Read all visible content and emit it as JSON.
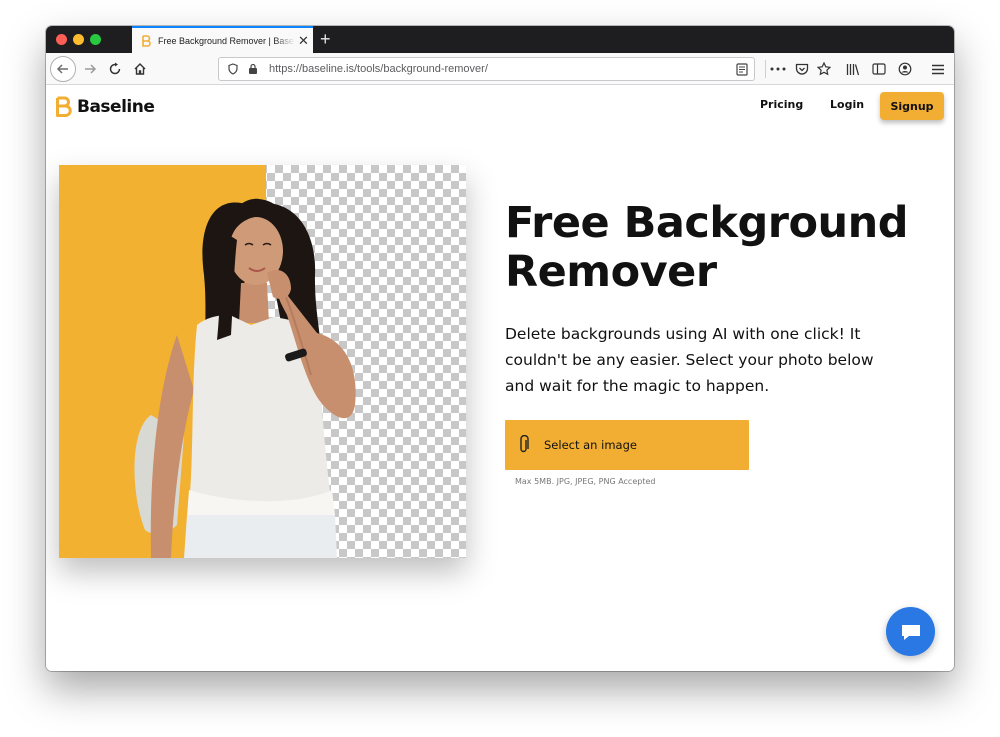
{
  "browser": {
    "tab": {
      "title": "Free Background Remover | Baseline",
      "close_icon": "close-icon"
    },
    "new_tab_symbol": "+",
    "url": "https://baseline.is/tools/background-remover/",
    "colors": {
      "tab_accent": "#0a84ff",
      "chrome_dark": "#1e1e20"
    }
  },
  "site": {
    "logo": {
      "name": "Baseline",
      "mark_icon": "baseline-logo-icon"
    },
    "nav": {
      "pricing": "Pricing",
      "login": "Login",
      "signup": "Signup"
    },
    "hero": {
      "title_line1": "Free Background",
      "title_line2": "Remover",
      "description": "Delete backgrounds using AI with one click! It couldn't be any easier. Select your photo below and wait for the magic to happen.",
      "select_button": "Select an image",
      "select_icon": "paperclip-icon",
      "hint": "Max 5MB. JPG, JPEG, PNG Accepted"
    },
    "chat_icon": "chat-icon",
    "colors": {
      "accent": "#f2ae32",
      "chat": "#2a78e3",
      "text": "#111111"
    }
  }
}
